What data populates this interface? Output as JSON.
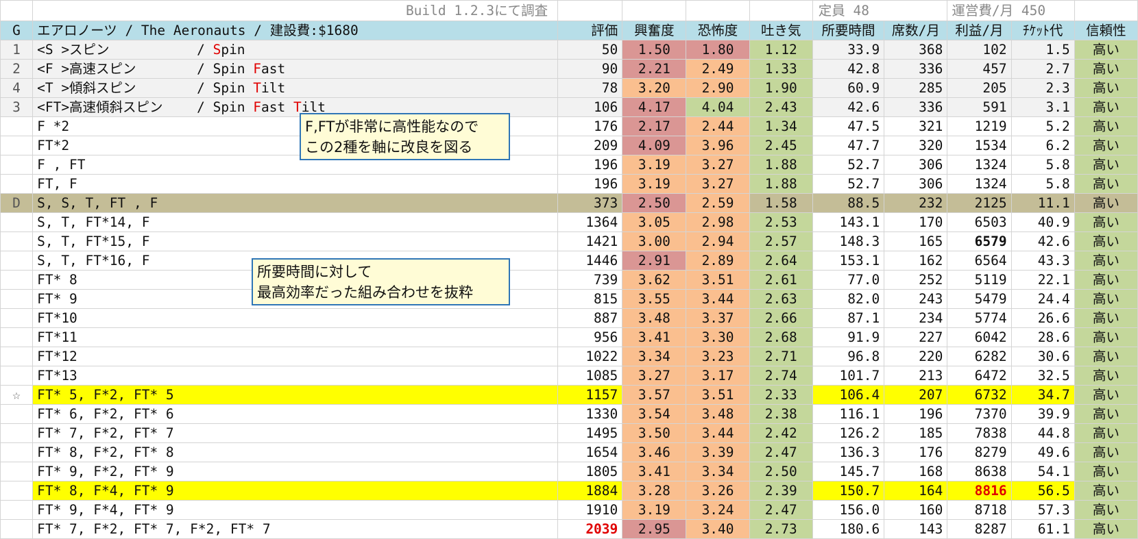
{
  "top": {
    "build": "Build 1.2.3にて調査",
    "capacity": "定員 48",
    "upkeep": "運営費/月 450"
  },
  "header": {
    "g": "G",
    "title": "エアロノーツ / The Aeronauts / 建設費:$1680",
    "cols": [
      "評価",
      "興奮度",
      "恐怖度",
      "吐き気",
      "所要時間",
      "席数/月",
      "利益/月",
      "ﾁｹｯﾄ代",
      "信頼性"
    ]
  },
  "modes": [
    {
      "g": "1",
      "jp": "<S >スピン",
      "en_pre": "/ ",
      "en": [
        [
          "S",
          true
        ],
        [
          "pin",
          false
        ]
      ]
    },
    {
      "g": "2",
      "jp": "<F >高速スピン",
      "en_pre": "/ ",
      "en": [
        [
          "Spin ",
          false
        ],
        [
          "F",
          true
        ],
        [
          "ast",
          false
        ]
      ]
    },
    {
      "g": "4",
      "jp": "<T >傾斜スピン",
      "en_pre": "/ ",
      "en": [
        [
          "Spin ",
          false
        ],
        [
          "T",
          true
        ],
        [
          "ilt",
          false
        ]
      ]
    },
    {
      "g": "3",
      "jp": "<FT>高速傾斜スピン",
      "en_pre": "/ ",
      "en": [
        [
          "Spin ",
          false
        ],
        [
          "F",
          true
        ],
        [
          "ast ",
          false
        ],
        [
          "T",
          true
        ],
        [
          "ilt",
          false
        ]
      ]
    }
  ],
  "rows": [
    {
      "g": "1",
      "label": "",
      "rating": "50",
      "exc": "1.50",
      "fear": "1.80",
      "nausea": "1.12",
      "time": "33.9",
      "seats": "368",
      "profit": "102",
      "ticket": "1.5",
      "rel": "高い",
      "ec": "#da9694",
      "fc": "#da9694"
    },
    {
      "g": "2",
      "label": "",
      "rating": "90",
      "exc": "2.21",
      "fear": "2.49",
      "nausea": "1.33",
      "time": "42.8",
      "seats": "336",
      "profit": "457",
      "ticket": "2.7",
      "rel": "高い",
      "ec": "#da9694",
      "fc": "#fabf8f"
    },
    {
      "g": "4",
      "label": "",
      "rating": "78",
      "exc": "3.20",
      "fear": "2.90",
      "nausea": "1.90",
      "time": "60.9",
      "seats": "285",
      "profit": "205",
      "ticket": "2.3",
      "rel": "高い",
      "ec": "#fabf8f",
      "fc": "#fabf8f"
    },
    {
      "g": "3",
      "label": "",
      "rating": "106",
      "exc": "4.17",
      "fear": "4.04",
      "nausea": "2.43",
      "time": "42.6",
      "seats": "336",
      "profit": "591",
      "ticket": "3.1",
      "rel": "高い",
      "ec": "#da9694",
      "fc": "#c4d79b"
    },
    {
      "g": "",
      "label": "F *2",
      "rating": "176",
      "exc": "2.17",
      "fear": "2.44",
      "nausea": "1.34",
      "time": "47.5",
      "seats": "321",
      "profit": "1219",
      "ticket": "5.2",
      "rel": "高い",
      "ec": "#da9694",
      "fc": "#fabf8f"
    },
    {
      "g": "",
      "label": "FT*2",
      "rating": "209",
      "exc": "4.09",
      "fear": "3.96",
      "nausea": "2.45",
      "time": "47.7",
      "seats": "320",
      "profit": "1534",
      "ticket": "6.2",
      "rel": "高い",
      "ec": "#da9694",
      "fc": "#fabf8f"
    },
    {
      "g": "",
      "label": "F , FT",
      "rating": "196",
      "exc": "3.19",
      "fear": "3.27",
      "nausea": "1.88",
      "time": "52.7",
      "seats": "306",
      "profit": "1324",
      "ticket": "5.8",
      "rel": "高い",
      "ec": "#fabf8f",
      "fc": "#fabf8f"
    },
    {
      "g": "",
      "label": "FT, F",
      "rating": "196",
      "exc": "3.19",
      "fear": "3.27",
      "nausea": "1.88",
      "time": "52.7",
      "seats": "306",
      "profit": "1324",
      "ticket": "5.8",
      "rel": "高い",
      "ec": "#fabf8f",
      "fc": "#fabf8f"
    },
    {
      "g": "D",
      "label": "S, S, T, FT , F",
      "rating": "373",
      "exc": "2.50",
      "fear": "2.59",
      "nausea": "1.58",
      "time": "88.5",
      "seats": "232",
      "profit": "2125",
      "ticket": "11.1",
      "rel": "高い",
      "ec": "#da9694",
      "fc": "#fabf8f",
      "rowclass": "hl-d"
    },
    {
      "g": "",
      "label": "S, T, FT*14, F",
      "rating": "1364",
      "exc": "3.05",
      "fear": "2.98",
      "nausea": "2.53",
      "time": "143.1",
      "seats": "170",
      "profit": "6503",
      "ticket": "40.9",
      "rel": "高い",
      "ec": "#fabf8f",
      "fc": "#fabf8f"
    },
    {
      "g": "",
      "label": "S, T, FT*15, F",
      "rating": "1421",
      "exc": "3.00",
      "fear": "2.94",
      "nausea": "2.57",
      "time": "148.3",
      "seats": "165",
      "profit": "6579",
      "ticket": "42.6",
      "rel": "高い",
      "ec": "#fabf8f",
      "fc": "#fabf8f",
      "profitclass": "bold"
    },
    {
      "g": "",
      "label": "S, T, FT*16, F",
      "rating": "1446",
      "exc": "2.91",
      "fear": "2.89",
      "nausea": "2.64",
      "time": "153.1",
      "seats": "162",
      "profit": "6564",
      "ticket": "43.3",
      "rel": "高い",
      "ec": "#da9694",
      "fc": "#fabf8f"
    },
    {
      "g": "",
      "label": "FT* 8",
      "rating": "739",
      "exc": "3.62",
      "fear": "3.51",
      "nausea": "2.61",
      "time": "77.0",
      "seats": "252",
      "profit": "5119",
      "ticket": "22.1",
      "rel": "高い",
      "ec": "#fabf8f",
      "fc": "#fabf8f"
    },
    {
      "g": "",
      "label": "FT* 9",
      "rating": "815",
      "exc": "3.55",
      "fear": "3.44",
      "nausea": "2.63",
      "time": "82.0",
      "seats": "243",
      "profit": "5479",
      "ticket": "24.4",
      "rel": "高い",
      "ec": "#fabf8f",
      "fc": "#fabf8f"
    },
    {
      "g": "",
      "label": "FT*10",
      "rating": "887",
      "exc": "3.48",
      "fear": "3.37",
      "nausea": "2.66",
      "time": "87.1",
      "seats": "234",
      "profit": "5774",
      "ticket": "26.6",
      "rel": "高い",
      "ec": "#fabf8f",
      "fc": "#fabf8f"
    },
    {
      "g": "",
      "label": "FT*11",
      "rating": "956",
      "exc": "3.41",
      "fear": "3.30",
      "nausea": "2.68",
      "time": "91.9",
      "seats": "227",
      "profit": "6042",
      "ticket": "28.6",
      "rel": "高い",
      "ec": "#fabf8f",
      "fc": "#fabf8f"
    },
    {
      "g": "",
      "label": "FT*12",
      "rating": "1022",
      "exc": "3.34",
      "fear": "3.23",
      "nausea": "2.71",
      "time": "96.8",
      "seats": "220",
      "profit": "6282",
      "ticket": "30.6",
      "rel": "高い",
      "ec": "#fabf8f",
      "fc": "#fabf8f"
    },
    {
      "g": "",
      "label": "FT*13",
      "rating": "1085",
      "exc": "3.27",
      "fear": "3.17",
      "nausea": "2.74",
      "time": "101.7",
      "seats": "213",
      "profit": "6472",
      "ticket": "32.5",
      "rel": "高い",
      "ec": "#fabf8f",
      "fc": "#fabf8f"
    },
    {
      "g": "☆",
      "label": "FT* 5, F*2, FT* 5",
      "rating": "1157",
      "exc": "3.57",
      "fear": "3.51",
      "nausea": "2.33",
      "time": "106.4",
      "seats": "207",
      "profit": "6732",
      "ticket": "34.7",
      "rel": "高い",
      "ec": "#fabf8f",
      "fc": "#fabf8f",
      "rowclass": "hl-y"
    },
    {
      "g": "",
      "label": "FT* 6, F*2, FT* 6",
      "rating": "1330",
      "exc": "3.54",
      "fear": "3.48",
      "nausea": "2.38",
      "time": "116.1",
      "seats": "196",
      "profit": "7370",
      "ticket": "39.9",
      "rel": "高い",
      "ec": "#fabf8f",
      "fc": "#fabf8f"
    },
    {
      "g": "",
      "label": "FT* 7, F*2, FT* 7",
      "rating": "1495",
      "exc": "3.50",
      "fear": "3.44",
      "nausea": "2.42",
      "time": "126.2",
      "seats": "185",
      "profit": "7838",
      "ticket": "44.8",
      "rel": "高い",
      "ec": "#fabf8f",
      "fc": "#fabf8f"
    },
    {
      "g": "",
      "label": "FT* 8, F*2, FT* 8",
      "rating": "1654",
      "exc": "3.46",
      "fear": "3.39",
      "nausea": "2.47",
      "time": "136.3",
      "seats": "176",
      "profit": "8279",
      "ticket": "49.6",
      "rel": "高い",
      "ec": "#fabf8f",
      "fc": "#fabf8f"
    },
    {
      "g": "",
      "label": "FT* 9, F*2, FT* 9",
      "rating": "1805",
      "exc": "3.41",
      "fear": "3.34",
      "nausea": "2.50",
      "time": "145.7",
      "seats": "168",
      "profit": "8638",
      "ticket": "54.1",
      "rel": "高い",
      "ec": "#fabf8f",
      "fc": "#fabf8f"
    },
    {
      "g": "",
      "label": "FT* 8, F*4, FT* 9",
      "rating": "1884",
      "exc": "3.28",
      "fear": "3.26",
      "nausea": "2.39",
      "time": "150.7",
      "seats": "164",
      "profit": "8816",
      "ticket": "56.5",
      "rel": "高い",
      "ec": "#fabf8f",
      "fc": "#fabf8f",
      "rowclass": "hl-y",
      "profitclass": "redbold"
    },
    {
      "g": "",
      "label": "FT* 9, F*4, FT* 9",
      "rating": "1910",
      "exc": "3.19",
      "fear": "3.24",
      "nausea": "2.47",
      "time": "156.0",
      "seats": "160",
      "profit": "8718",
      "ticket": "57.3",
      "rel": "高い",
      "ec": "#fabf8f",
      "fc": "#fabf8f"
    },
    {
      "g": "",
      "label": "FT* 7, F*2, FT* 7, F*2, FT* 7",
      "rating": "2039",
      "exc": "2.95",
      "fear": "3.40",
      "nausea": "2.73",
      "time": "180.6",
      "seats": "143",
      "profit": "8287",
      "ticket": "61.1",
      "rel": "高い",
      "ec": "#da9694",
      "fc": "#fabf8f",
      "ratingclass": "redbold"
    }
  ],
  "notes": {
    "note1_line1": "F,FTが非常に高性能なので",
    "note1_line2": "この2種を軸に改良を図る",
    "note2_line1": "所要時間に対して",
    "note2_line2": "最高効率だった組み合わせを抜粋"
  },
  "colors": {
    "header_bg": "#b7dee8",
    "exc_red": "#da9694",
    "exc_orange": "#fabf8f",
    "green": "#c4d79b",
    "highlight_yellow": "#ffff00",
    "highlight_d": "#c4bd97",
    "note_border": "#2e75b6"
  }
}
